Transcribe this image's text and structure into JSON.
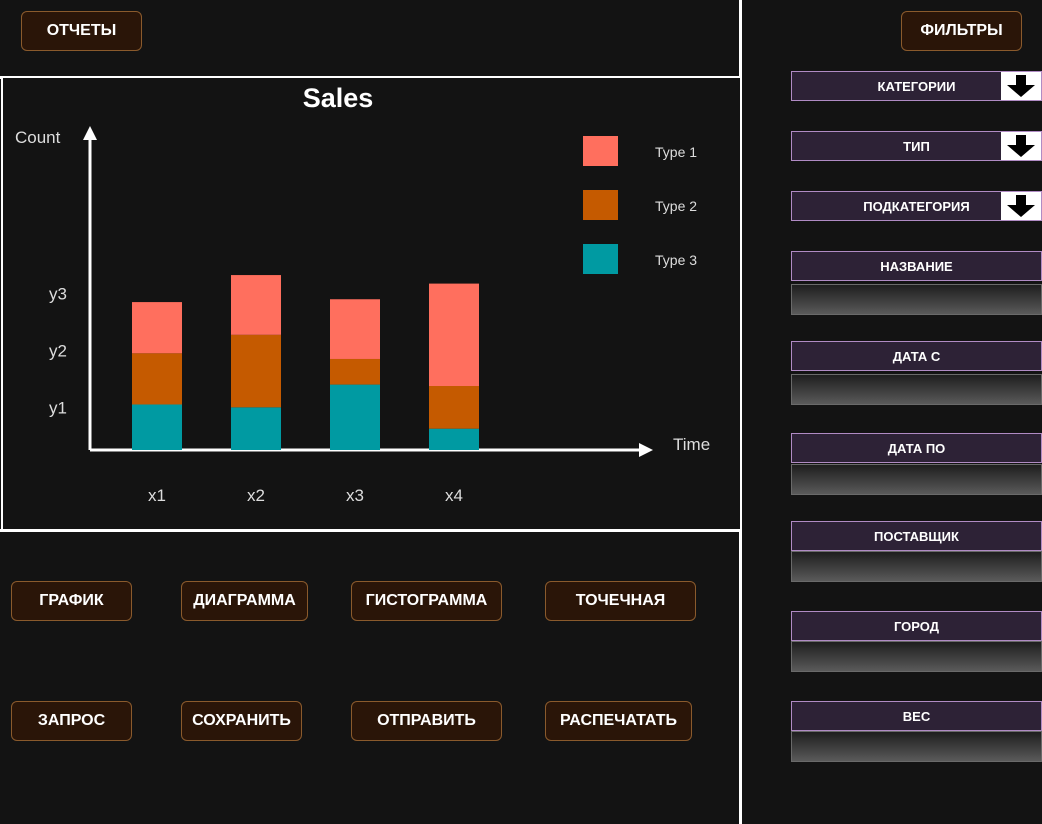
{
  "header": {
    "reports_label": "ОТЧЕТЫ"
  },
  "filters": {
    "title_label": "ФИЛЬТРЫ",
    "dropdowns": [
      {
        "label": "КАТЕГОРИИ"
      },
      {
        "label": "ТИП"
      },
      {
        "label": "ПОДКАТЕГОРИЯ"
      }
    ],
    "fields": [
      {
        "label": "НАЗВАНИЕ",
        "value": ""
      },
      {
        "label": "ДАТА С",
        "value": ""
      },
      {
        "label": "ДАТА ПО",
        "value": ""
      },
      {
        "label": "ПОСТАВЩИК",
        "value": ""
      },
      {
        "label": "ГОРОД",
        "value": ""
      },
      {
        "label": "ВЕС",
        "value": ""
      }
    ]
  },
  "chart_buttons": [
    {
      "label": "ГРАФИК"
    },
    {
      "label": "ДИАГРАММА"
    },
    {
      "label": "ГИСТОГРАММА"
    },
    {
      "label": "ТОЧЕЧНАЯ"
    }
  ],
  "action_buttons": [
    {
      "label": "ЗАПРОС"
    },
    {
      "label": "СОХРАНИТЬ"
    },
    {
      "label": "ОТПРАВИТЬ"
    },
    {
      "label": "РАСПЕЧАТАТЬ"
    }
  ],
  "chart_data": {
    "type": "bar",
    "stacked": true,
    "title": "Sales",
    "xlabel": "Time",
    "ylabel": "Count",
    "categories": [
      "x1",
      "x2",
      "x3",
      "x4"
    ],
    "y_tick_labels": [
      {
        "label": "y1",
        "value": 1.5
      },
      {
        "label": "y2",
        "value": 3.5
      },
      {
        "label": "y3",
        "value": 5.5
      }
    ],
    "ylim": [
      0,
      9
    ],
    "legend_position": "top-right",
    "grid": false,
    "series": [
      {
        "name": "Type 3",
        "color": "#009aa2",
        "values": [
          1.6,
          1.5,
          2.3,
          0.75
        ]
      },
      {
        "name": "Type 2",
        "color": "#c55a00",
        "values": [
          1.8,
          2.55,
          0.9,
          1.5
        ]
      },
      {
        "name": "Type 1",
        "color": "#ff6f5e",
        "values": [
          1.8,
          2.1,
          2.1,
          3.6
        ]
      }
    ],
    "legend_order": [
      "Type 1",
      "Type 2",
      "Type 3"
    ]
  }
}
